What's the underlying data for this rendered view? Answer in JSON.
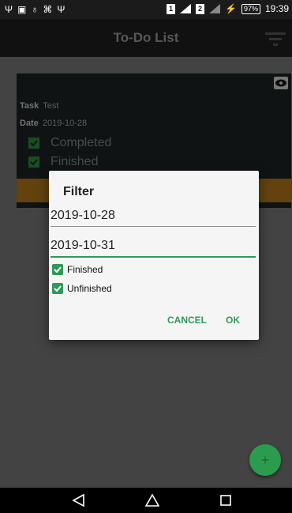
{
  "status_bar": {
    "left_icons": [
      "usb-icon",
      "image-icon",
      "bulb-icon",
      "mouse-icon",
      "usb-icon"
    ],
    "sim1": "1",
    "sim2": "2",
    "battery": "97%",
    "time": "19:39"
  },
  "toolbar": {
    "title": "To-Do List",
    "filter_icon": "filter-icon"
  },
  "card": {
    "task_label": "Task",
    "task_value": "Test",
    "date_label": "Date",
    "date_value": "2019-10-28",
    "checkboxes": [
      {
        "label": "Completed",
        "checked": true
      },
      {
        "label": "Finished",
        "checked": true
      }
    ]
  },
  "dialog": {
    "title": "Filter",
    "start_date": "2019-10-28",
    "end_date": "2019-10-31",
    "options": [
      {
        "label": "Finished",
        "checked": true
      },
      {
        "label": "Unfinished",
        "checked": true
      }
    ],
    "cancel_label": "CANCEL",
    "ok_label": "OK"
  },
  "fab": {
    "symbol": "+"
  },
  "colors": {
    "accent": "#2e9a5a",
    "orange": "#b5781a",
    "card_bg": "#1e2325"
  }
}
